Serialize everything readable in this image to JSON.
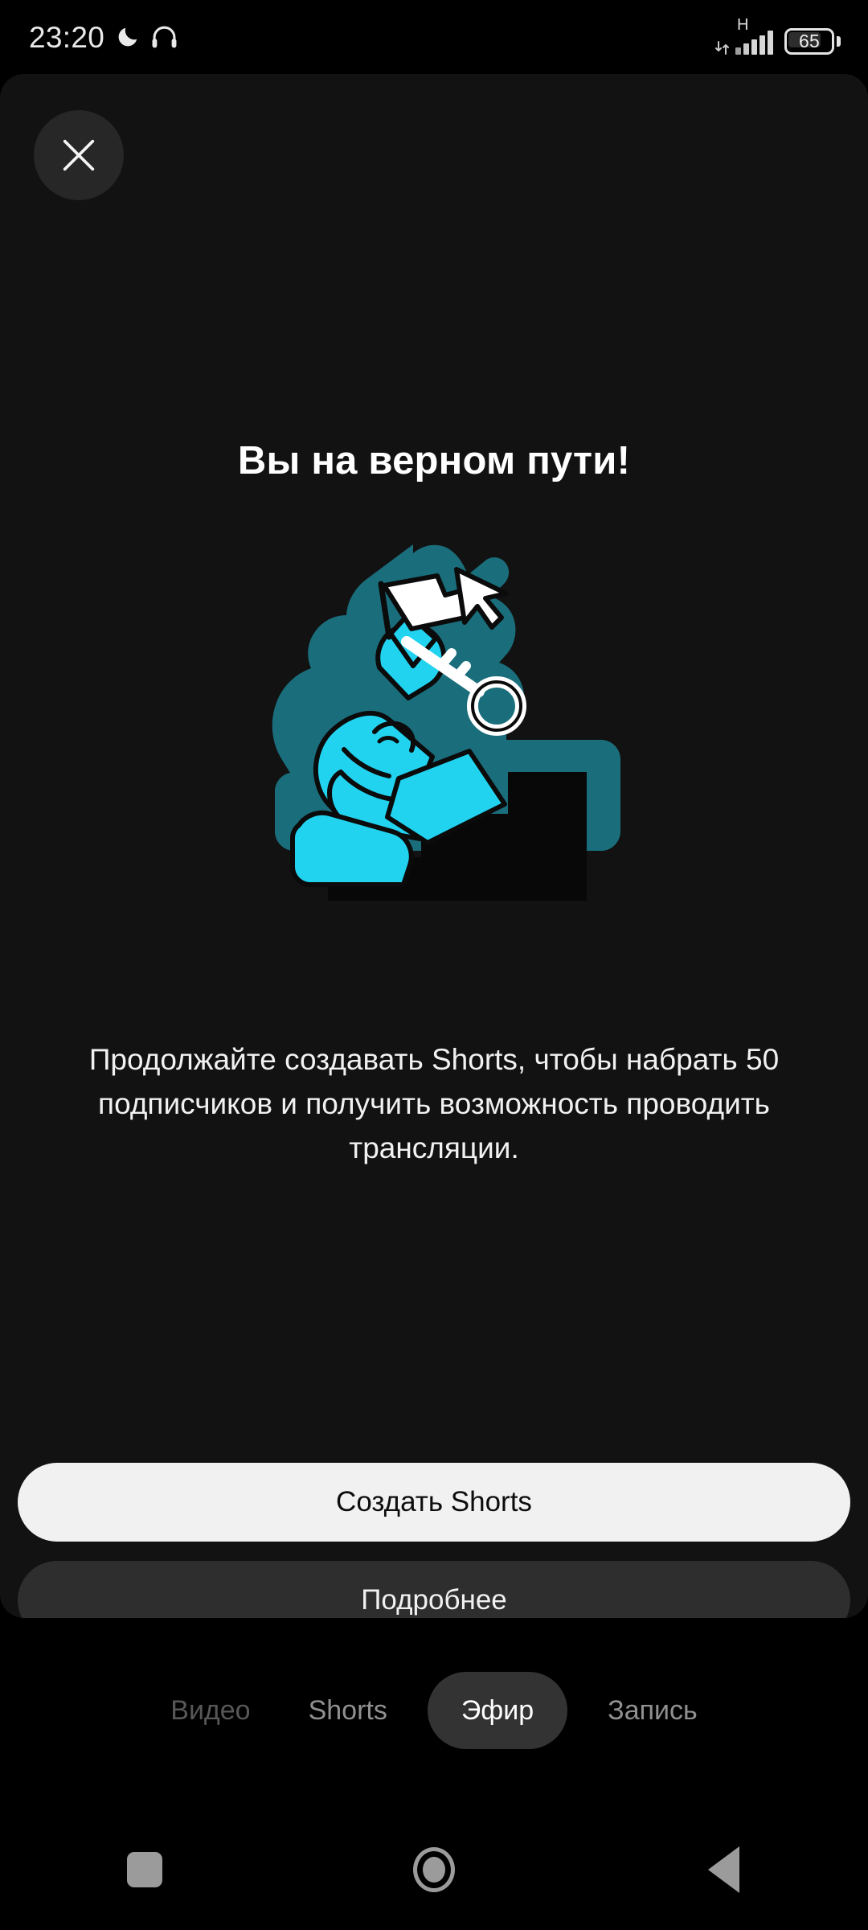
{
  "status_bar": {
    "time": "23:20",
    "dnd_icon": "moon-icon",
    "headset_icon": "headphones-icon",
    "network_type": "H",
    "signal_icon": "signal-bars-icon",
    "data_arrows_icon": "data-transfer-icon",
    "battery_percent": "65"
  },
  "sheet": {
    "close_label": "close-icon",
    "title": "Вы на верном пути!",
    "illustration_name": "person-climbing-stairs-with-flag-and-key",
    "body_text": "Продолжайте создавать Shorts, чтобы набрать 50 подписчиков и получить возможность проводить трансляции.",
    "primary_button": "Создать Shorts",
    "secondary_button": "Подробнее"
  },
  "mode_tabs": [
    {
      "label": "Видео",
      "state": "disabled"
    },
    {
      "label": "Shorts",
      "state": "inactive"
    },
    {
      "label": "Эфир",
      "state": "active"
    },
    {
      "label": "Запись",
      "state": "inactive"
    }
  ],
  "nav_bar": {
    "recents": "recents-square-icon",
    "home": "home-circle-icon",
    "back": "back-triangle-icon"
  },
  "colors": {
    "background": "#000000",
    "sheet": "#121212",
    "primary_button_bg": "#f1f1f1",
    "secondary_button_bg": "#2e2e2e",
    "active_tab_bg": "#333333",
    "accent_cyan": "#22d3f0",
    "accent_teal": "#1a6e7c",
    "text_primary": "#ffffff",
    "text_muted": "#909090"
  }
}
